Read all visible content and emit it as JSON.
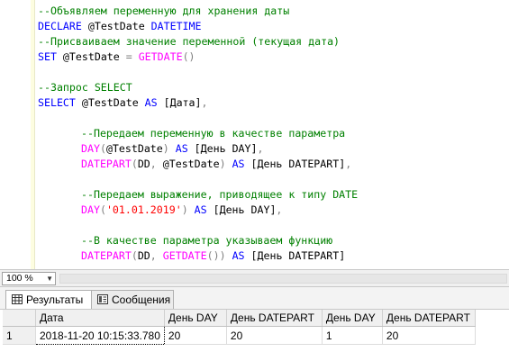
{
  "editor": {
    "lines": [
      {
        "id": "l1",
        "segments": [
          {
            "cls": "cm",
            "text": "--Объявляем переменную для хранения даты"
          }
        ]
      },
      {
        "id": "l2",
        "segments": [
          {
            "cls": "kw",
            "text": "DECLARE"
          },
          {
            "cls": "",
            "text": " @TestDate "
          },
          {
            "cls": "kw",
            "text": "DATETIME"
          }
        ]
      },
      {
        "id": "l3",
        "segments": [
          {
            "cls": "cm",
            "text": "--Присваиваем значение переменной (текущая дата)"
          }
        ]
      },
      {
        "id": "l4",
        "segments": [
          {
            "cls": "kw",
            "text": "SET"
          },
          {
            "cls": "",
            "text": " @TestDate "
          },
          {
            "cls": "op",
            "text": "="
          },
          {
            "cls": "",
            "text": " "
          },
          {
            "cls": "fn",
            "text": "GETDATE"
          },
          {
            "cls": "op",
            "text": "()"
          }
        ]
      },
      {
        "id": "l5",
        "segments": []
      },
      {
        "id": "l6",
        "segments": [
          {
            "cls": "cm",
            "text": "--Запрос SELECT"
          }
        ]
      },
      {
        "id": "l7",
        "segments": [
          {
            "cls": "kw",
            "text": "SELECT"
          },
          {
            "cls": "",
            "text": " @TestDate "
          },
          {
            "cls": "kw",
            "text": "AS"
          },
          {
            "cls": "",
            "text": " [Дата]"
          },
          {
            "cls": "op",
            "text": ","
          }
        ]
      },
      {
        "id": "l8",
        "segments": []
      },
      {
        "id": "l9",
        "indent": true,
        "segments": [
          {
            "cls": "cm",
            "text": "--Передаем переменную в качестве параметра"
          }
        ]
      },
      {
        "id": "l10",
        "indent": true,
        "segments": [
          {
            "cls": "fn",
            "text": "DAY"
          },
          {
            "cls": "op",
            "text": "("
          },
          {
            "cls": "",
            "text": "@TestDate"
          },
          {
            "cls": "op",
            "text": ")"
          },
          {
            "cls": "",
            "text": " "
          },
          {
            "cls": "kw",
            "text": "AS"
          },
          {
            "cls": "",
            "text": " [День DAY]"
          },
          {
            "cls": "op",
            "text": ","
          }
        ]
      },
      {
        "id": "l11",
        "indent": true,
        "segments": [
          {
            "cls": "fn",
            "text": "DATEPART"
          },
          {
            "cls": "op",
            "text": "("
          },
          {
            "cls": "",
            "text": "DD"
          },
          {
            "cls": "op",
            "text": ","
          },
          {
            "cls": "",
            "text": " @TestDate"
          },
          {
            "cls": "op",
            "text": ")"
          },
          {
            "cls": "",
            "text": " "
          },
          {
            "cls": "kw",
            "text": "AS"
          },
          {
            "cls": "",
            "text": " [День DATEPART]"
          },
          {
            "cls": "op",
            "text": ","
          }
        ]
      },
      {
        "id": "l12",
        "segments": []
      },
      {
        "id": "l13",
        "indent": true,
        "segments": [
          {
            "cls": "cm",
            "text": "--Передаем выражение, приводящее к типу DATE"
          }
        ]
      },
      {
        "id": "l14",
        "indent": true,
        "segments": [
          {
            "cls": "fn",
            "text": "DAY"
          },
          {
            "cls": "op",
            "text": "("
          },
          {
            "cls": "st",
            "text": "'01.01.2019'"
          },
          {
            "cls": "op",
            "text": ")"
          },
          {
            "cls": "",
            "text": " "
          },
          {
            "cls": "kw",
            "text": "AS"
          },
          {
            "cls": "",
            "text": " [День DAY]"
          },
          {
            "cls": "op",
            "text": ","
          }
        ]
      },
      {
        "id": "l15",
        "segments": []
      },
      {
        "id": "l16",
        "indent": true,
        "segments": [
          {
            "cls": "cm",
            "text": "--В качестве параметра указываем функцию"
          }
        ]
      },
      {
        "id": "l17",
        "indent": true,
        "segments": [
          {
            "cls": "fn",
            "text": "DATEPART"
          },
          {
            "cls": "op",
            "text": "("
          },
          {
            "cls": "",
            "text": "DD"
          },
          {
            "cls": "op",
            "text": ","
          },
          {
            "cls": "",
            "text": " "
          },
          {
            "cls": "fn",
            "text": "GETDATE"
          },
          {
            "cls": "op",
            "text": "())"
          },
          {
            "cls": "",
            "text": " "
          },
          {
            "cls": "kw",
            "text": "AS"
          },
          {
            "cls": "",
            "text": " [День DATEPART]"
          }
        ]
      }
    ]
  },
  "statusbar": {
    "zoom": "100 %"
  },
  "tabs": {
    "results_label": "Результаты",
    "messages_label": "Сообщения"
  },
  "results": {
    "columns": [
      "Дата",
      "День DAY",
      "День DATEPART",
      "День DAY",
      "День DATEPART"
    ],
    "rows": [
      {
        "num": "1",
        "cells": [
          "2018-11-20 10:15:33.780",
          "20",
          "20",
          "1",
          "20"
        ]
      }
    ]
  },
  "colors": {
    "keyword": "#0000ff",
    "comment": "#008000",
    "function": "#ff00ff",
    "string": "#ff0000",
    "operator": "#808080"
  }
}
